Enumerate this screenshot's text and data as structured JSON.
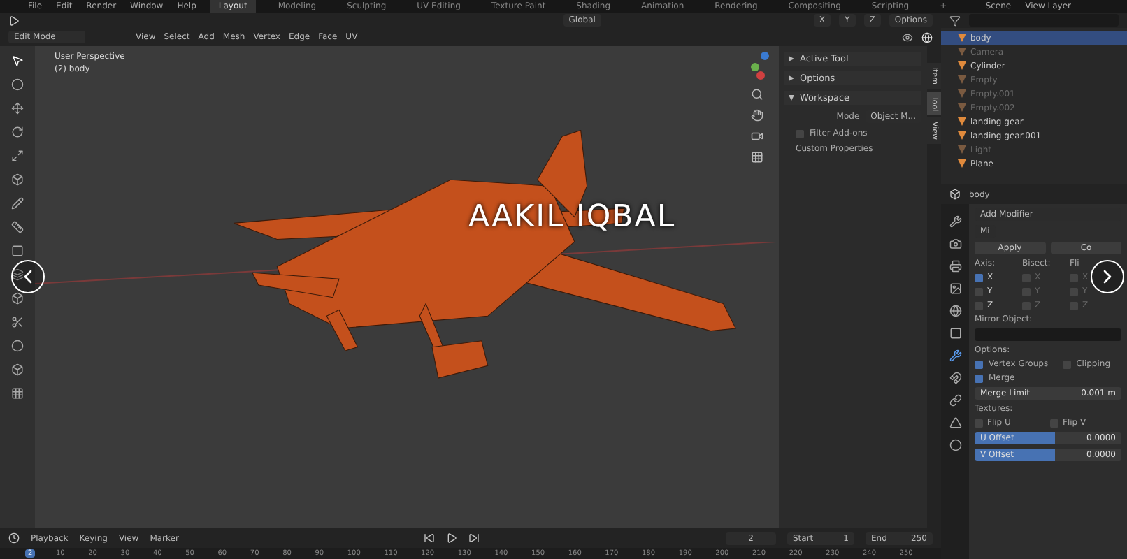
{
  "menu": [
    "File",
    "Edit",
    "Render",
    "Window",
    "Help"
  ],
  "workspaces": [
    {
      "label": "Layout",
      "selected": true
    },
    {
      "label": "Modeling",
      "selected": false
    },
    {
      "label": "Sculpting",
      "selected": false
    },
    {
      "label": "UV Editing",
      "selected": false
    },
    {
      "label": "Texture Paint",
      "selected": false
    },
    {
      "label": "Shading",
      "selected": false
    },
    {
      "label": "Animation",
      "selected": false
    },
    {
      "label": "Rendering",
      "selected": false
    },
    {
      "label": "Compositing",
      "selected": false
    },
    {
      "label": "Scripting",
      "selected": false
    },
    {
      "label": "+",
      "selected": false
    }
  ],
  "scene": "Scene",
  "view_layer": "View Layer",
  "tool_header": {
    "orientation": "Global",
    "options": "Options",
    "axes": [
      "X",
      "Y",
      "Z"
    ]
  },
  "editor_header": {
    "mode": "Edit Mode",
    "menus": [
      "View",
      "Select",
      "Add",
      "Mesh",
      "Vertex",
      "Edge",
      "Face",
      "UV"
    ]
  },
  "viewport": {
    "view_name": "User Perspective",
    "object_info": "(2) body"
  },
  "overlay_title": "AAKIL IQBAL",
  "sidebar": {
    "panels": [
      {
        "label": "Active Tool",
        "expanded": false
      },
      {
        "label": "Options",
        "expanded": false
      },
      {
        "label": "Workspace",
        "expanded": true
      }
    ],
    "mode_label": "Mode",
    "mode_value": "Object M...",
    "subpanels": [
      {
        "label": "Filter Add-ons",
        "checked": false
      },
      {
        "label": "Custom Properties"
      }
    ],
    "tabs": [
      {
        "label": "Item",
        "selected": false
      },
      {
        "label": "Tool",
        "selected": true
      },
      {
        "label": "View",
        "selected": false
      }
    ]
  },
  "outliner": {
    "items": [
      {
        "name": "body",
        "selected": true,
        "hidden": false
      },
      {
        "name": "Camera",
        "selected": false,
        "hidden": true
      },
      {
        "name": "Cylinder",
        "selected": false,
        "hidden": false
      },
      {
        "name": "Empty",
        "selected": false,
        "hidden": true
      },
      {
        "name": "Empty.001",
        "selected": false,
        "hidden": true
      },
      {
        "name": "Empty.002",
        "selected": false,
        "hidden": true
      },
      {
        "name": "landing gear",
        "selected": false,
        "hidden": false
      },
      {
        "name": "landing gear.001",
        "selected": false,
        "hidden": false
      },
      {
        "name": "Light",
        "selected": false,
        "hidden": true
      },
      {
        "name": "Plane",
        "selected": false,
        "hidden": false
      }
    ]
  },
  "properties": {
    "object": "body",
    "add_modifier": "Add Modifier",
    "modifier_name": "Mi",
    "apply": "Apply",
    "copy": "Co",
    "axis_heads": [
      "Axis:",
      "Bisect:",
      "Fli"
    ],
    "axis_rows": [
      {
        "labels": [
          "X",
          "X",
          "X"
        ],
        "checked": [
          true,
          false,
          false
        ]
      },
      {
        "labels": [
          "Y",
          "Y",
          "Y"
        ],
        "checked": [
          false,
          false,
          false
        ]
      },
      {
        "labels": [
          "Z",
          "Z",
          "Z"
        ],
        "checked": [
          false,
          false,
          false
        ]
      }
    ],
    "mirror_object": "Mirror Object:",
    "options_head": "Options:",
    "options": [
      {
        "label": "Vertex Groups",
        "checked": true
      },
      {
        "label": "Clipping",
        "checked": false
      },
      {
        "label": "Merge",
        "checked": true
      }
    ],
    "merge_limit": {
      "label": "Merge Limit",
      "value": "0.001 m"
    },
    "textures_head": "Textures:",
    "flips": [
      {
        "label": "Flip U",
        "checked": false
      },
      {
        "label": "Flip V",
        "checked": false
      }
    ],
    "offsets": [
      {
        "label": "U Offset",
        "value": "0.0000"
      },
      {
        "label": "V Offset",
        "value": "0.0000"
      }
    ]
  },
  "timeline": {
    "menus": [
      "Playback",
      "Keying",
      "View",
      "Marker"
    ],
    "current": "2",
    "start_label": "Start",
    "start": "1",
    "end_label": "End",
    "end": "250"
  },
  "ruler": [
    {
      "label": "2",
      "selected": true
    },
    {
      "label": "10",
      "selected": false
    },
    {
      "label": "20",
      "selected": false
    },
    {
      "label": "30",
      "selected": false
    },
    {
      "label": "40",
      "selected": false
    },
    {
      "label": "50",
      "selected": false
    },
    {
      "label": "60",
      "selected": false
    },
    {
      "label": "70",
      "selected": false
    },
    {
      "label": "80",
      "selected": false
    },
    {
      "label": "90",
      "selected": false
    },
    {
      "label": "100",
      "selected": false
    },
    {
      "label": "110",
      "selected": false
    },
    {
      "label": "120",
      "selected": false
    },
    {
      "label": "130",
      "selected": false
    },
    {
      "label": "140",
      "selected": false
    },
    {
      "label": "150",
      "selected": false
    },
    {
      "label": "160",
      "selected": false
    },
    {
      "label": "170",
      "selected": false
    },
    {
      "label": "180",
      "selected": false
    },
    {
      "label": "190",
      "selected": false
    },
    {
      "label": "200",
      "selected": false
    },
    {
      "label": "210",
      "selected": false
    },
    {
      "label": "220",
      "selected": false
    },
    {
      "label": "230",
      "selected": false
    },
    {
      "label": "240",
      "selected": false
    },
    {
      "label": "250",
      "selected": false
    }
  ]
}
